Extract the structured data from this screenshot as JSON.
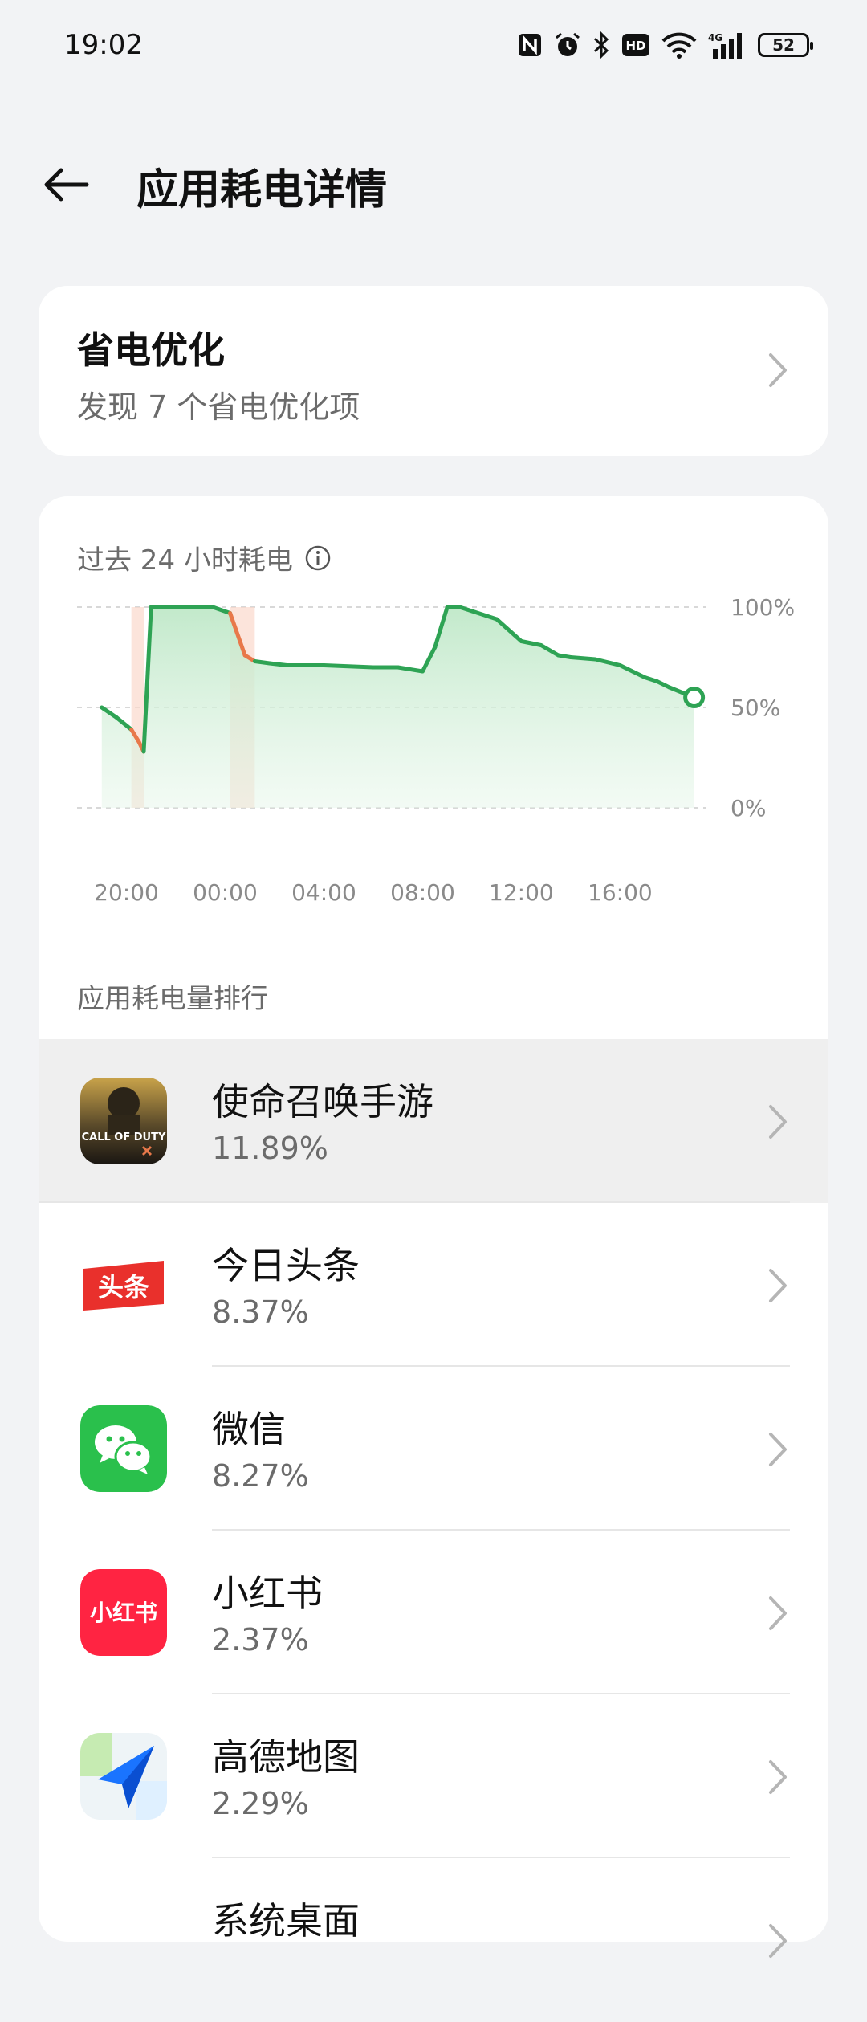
{
  "status_bar": {
    "time": "19:02",
    "battery": "52",
    "icons": [
      "nfc-icon",
      "alarm-icon",
      "bluetooth-icon",
      "hd-icon",
      "wifi-icon",
      "4g-signal-icon",
      "battery-icon"
    ],
    "hd_label": "HD",
    "net_label": "4G"
  },
  "header": {
    "title": "应用耗电详情",
    "back_icon": "back-arrow-icon"
  },
  "save_card": {
    "title": "省电优化",
    "subtitle": "发现 7 个省电优化项"
  },
  "usage_card": {
    "title": "过去 24 小时耗电",
    "ranking_title": "应用耗电量排行"
  },
  "colors": {
    "line": "#2ea354",
    "discharge_fast": "#e8784a",
    "fill": "#cdeed5",
    "highlight_row": "#efefef"
  },
  "chart_data": {
    "type": "area",
    "title": "",
    "xlabel": "",
    "ylabel": "",
    "y_ticks": [
      "100%",
      "50%",
      "0%"
    ],
    "x_ticks": [
      "20:00",
      "00:00",
      "04:00",
      "08:00",
      "12:00",
      "16:00"
    ],
    "ylim": [
      0,
      100
    ],
    "series": [
      {
        "x": [
          19.0,
          19.6,
          20.2,
          20.5,
          20.7,
          21.0,
          22.0,
          23.0,
          23.5,
          24.2,
          24.8,
          25.2,
          25.8,
          26.5,
          28.0,
          30.0,
          31.0,
          32.0,
          32.5,
          33.0,
          33.5,
          34.0,
          35.0,
          36.0,
          36.8,
          37.5,
          38.0,
          39.0,
          40.0,
          41.0,
          41.5,
          42.0,
          43.0
        ],
        "y": [
          50,
          45,
          39,
          33,
          28,
          100,
          100,
          100,
          100,
          97,
          76,
          73,
          72,
          71,
          71,
          70,
          70,
          68,
          80,
          100,
          100,
          98,
          94,
          83,
          81,
          76,
          75,
          74,
          71,
          65,
          63,
          60,
          55
        ]
      }
    ],
    "fast_discharge_ranges": [
      [
        20.2,
        20.7
      ],
      [
        24.2,
        25.2
      ]
    ],
    "grid": true,
    "current_marker": {
      "x": 43.0,
      "y": 55
    }
  },
  "apps": [
    {
      "name": "使命召唤手游",
      "percent": "11.89%",
      "icon": "call-of-duty-icon",
      "icon_text": "CALL OF DUTY",
      "highlighted": true
    },
    {
      "name": "今日头条",
      "percent": "8.37%",
      "icon": "toutiao-icon",
      "icon_text": "头条"
    },
    {
      "name": "微信",
      "percent": "8.27%",
      "icon": "wechat-icon"
    },
    {
      "name": "小红书",
      "percent": "2.37%",
      "icon": "xiaohongshu-icon",
      "icon_text": "小红书"
    },
    {
      "name": "高德地图",
      "percent": "2.29%",
      "icon": "amap-icon"
    },
    {
      "name": "系统桌面",
      "percent": "",
      "icon": ""
    }
  ]
}
